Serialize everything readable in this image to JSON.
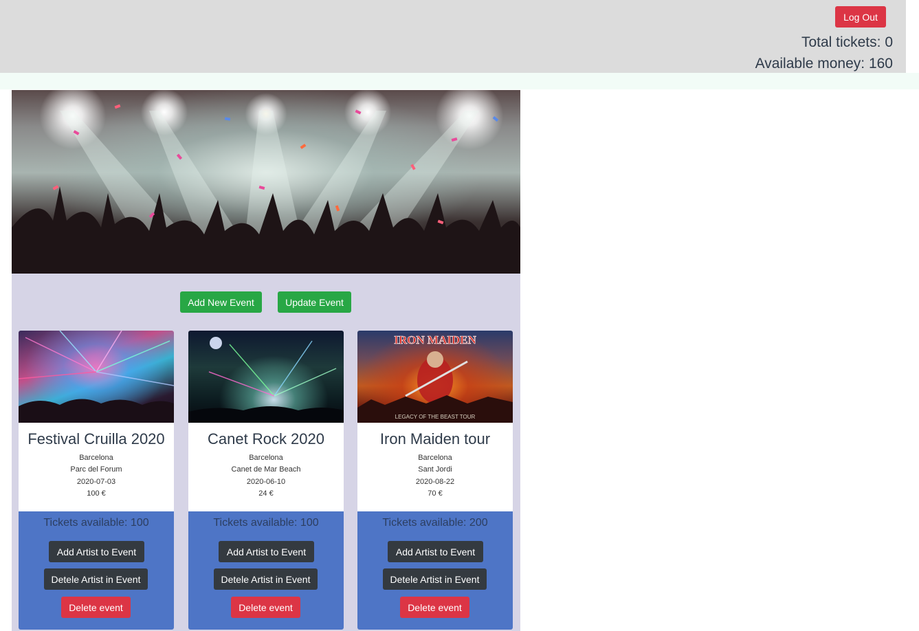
{
  "header": {
    "logout_label": "Log Out",
    "total_tickets": "Total tickets: 0",
    "available_money": "Available money: 160"
  },
  "actions": {
    "add_event_label": "Add New Event",
    "update_event_label": "Update Event"
  },
  "events": [
    {
      "title": "Festival Cruilla 2020",
      "city": "Barcelona",
      "venue": "Parc del Forum",
      "date": "2020-07-03",
      "price": "100 €",
      "tickets": "Tickets available: 100",
      "add_artist_label": "Add Artist to Event",
      "delete_artist_label": "Detele Artist in Event",
      "delete_event_label": "Delete event"
    },
    {
      "title": "Canet Rock 2020",
      "city": "Barcelona",
      "venue": "Canet de Mar Beach",
      "date": "2020-06-10",
      "price": "24 €",
      "tickets": "Tickets available: 100",
      "add_artist_label": "Add Artist to Event",
      "delete_artist_label": "Detele Artist in Event",
      "delete_event_label": "Delete event"
    },
    {
      "title": "Iron Maiden tour",
      "city": "Barcelona",
      "venue": "Sant Jordi",
      "date": "2020-08-22",
      "price": "70 €",
      "tickets": "Tickets available: 200",
      "add_artist_label": "Add Artist to Event",
      "delete_artist_label": "Detele Artist in Event",
      "delete_event_label": "Delete event",
      "poster_text": "IRON MAIDEN",
      "poster_subtitle": "LEGACY OF THE BEAST TOUR"
    }
  ],
  "colors": {
    "danger": "#dc3545",
    "success": "#28a745",
    "dark": "#343a40",
    "card_footer": "#4e75c6",
    "panel": "#d6d4e6",
    "topbar": "#dcdcdc"
  }
}
